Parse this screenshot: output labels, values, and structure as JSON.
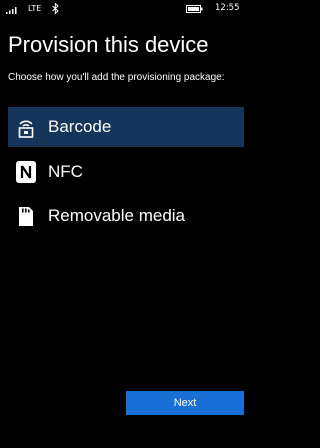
{
  "status_bar": {
    "signal_icon": "signal-bars-icon",
    "network": "LTE",
    "bluetooth_icon": "bluetooth-icon",
    "battery_icon": "battery-icon",
    "time": "12:55"
  },
  "page": {
    "title": "Provision this device",
    "subtitle": "Choose how you'll add the provisioning package:"
  },
  "options": [
    {
      "label": "Barcode",
      "icon": "barcode-scanner-icon",
      "selected": true
    },
    {
      "label": "NFC",
      "icon": "nfc-icon",
      "selected": false
    },
    {
      "label": "Removable media",
      "icon": "sd-card-icon",
      "selected": false
    }
  ],
  "footer": {
    "next_label": "Next"
  },
  "colors": {
    "background": "#000000",
    "selected_option": "#15355a",
    "accent_button": "#1a6fd6",
    "text": "#ffffff"
  }
}
